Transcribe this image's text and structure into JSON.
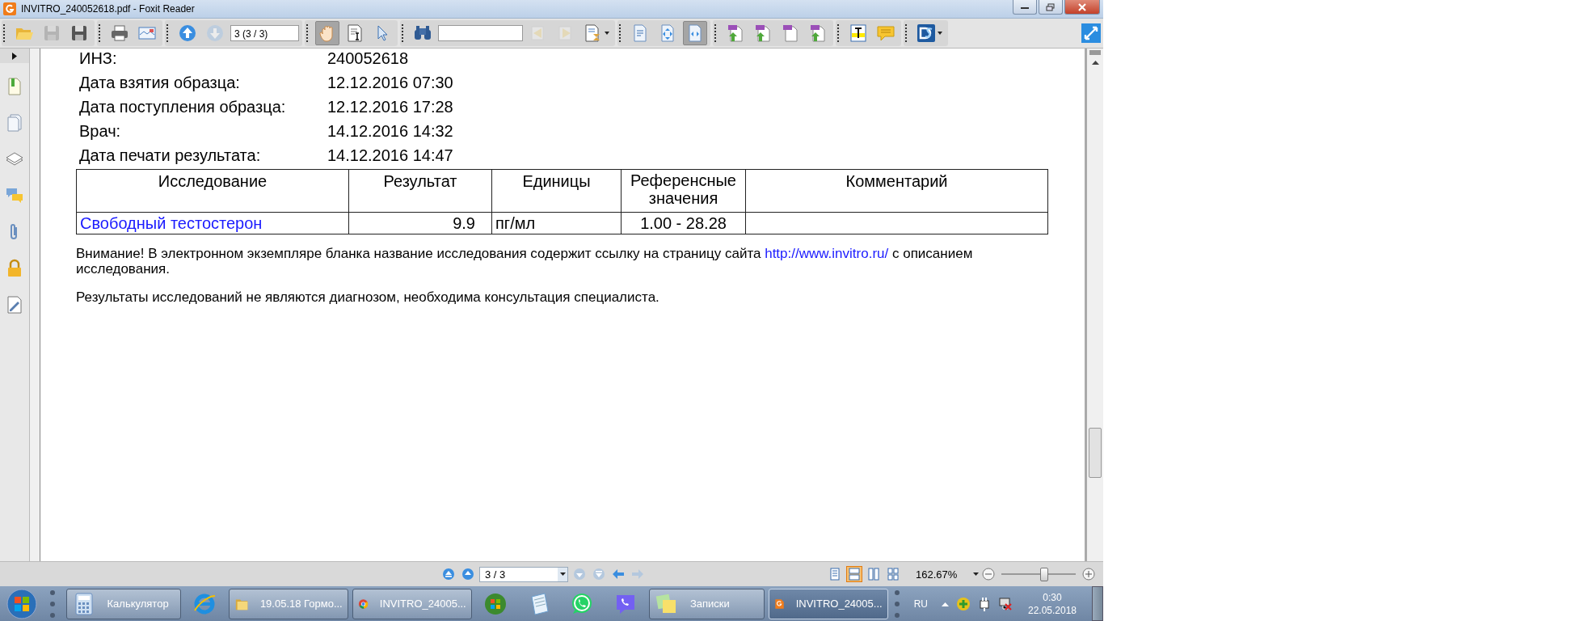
{
  "window": {
    "title": "INVITRO_240052618.pdf - Foxit Reader"
  },
  "toolbar": {
    "groups": [
      [
        {
          "kind": "open",
          "selected": false,
          "disabled": false
        },
        {
          "kind": "save",
          "selected": false,
          "disabled": true
        },
        {
          "kind": "save-as",
          "selected": false,
          "disabled": false
        }
      ],
      [
        {
          "kind": "print",
          "selected": false,
          "disabled": false
        },
        {
          "kind": "email",
          "selected": false,
          "disabled": false
        }
      ],
      [
        {
          "kind": "page-up",
          "selected": false,
          "disabled": false
        },
        {
          "kind": "page-down",
          "selected": false,
          "disabled": true
        },
        {
          "kind": "page-field",
          "value": "3 (3 / 3)"
        }
      ],
      [
        {
          "kind": "hand",
          "selected": true,
          "disabled": false
        },
        {
          "kind": "select-text",
          "selected": false,
          "disabled": false
        },
        {
          "kind": "pointer",
          "selected": false,
          "disabled": false
        }
      ],
      [
        {
          "kind": "find",
          "selected": false,
          "disabled": false
        },
        {
          "kind": "search-field"
        },
        {
          "kind": "find-prev",
          "selected": false,
          "disabled": true
        },
        {
          "kind": "find-next",
          "selected": false,
          "disabled": true
        },
        {
          "kind": "find-options",
          "selected": false,
          "disabled": false
        }
      ],
      [
        {
          "kind": "actual-size",
          "selected": false,
          "disabled": false
        },
        {
          "kind": "fit-page",
          "selected": false,
          "disabled": false
        },
        {
          "kind": "fit-width",
          "selected": true,
          "disabled": false
        }
      ],
      [
        {
          "kind": "pdf-upload",
          "selected": false,
          "disabled": false
        },
        {
          "kind": "pdf-print",
          "selected": false,
          "disabled": false
        },
        {
          "kind": "pdf-blank",
          "selected": false,
          "disabled": false
        },
        {
          "kind": "pdf-copy",
          "selected": false,
          "disabled": false
        }
      ],
      [
        {
          "kind": "typewriter",
          "selected": false,
          "disabled": false
        },
        {
          "kind": "note",
          "selected": false,
          "disabled": false
        }
      ],
      [
        {
          "kind": "app",
          "selected": false,
          "disabled": false
        }
      ]
    ]
  },
  "sidebar": {
    "items": [
      {
        "kind": "bookmarks"
      },
      {
        "kind": "pages"
      },
      {
        "kind": "layers"
      },
      {
        "kind": "comments"
      },
      {
        "kind": "attachments"
      },
      {
        "kind": "security"
      },
      {
        "kind": "signature"
      }
    ]
  },
  "document": {
    "info": [
      {
        "label": "ИНЗ:",
        "value": "240052618"
      },
      {
        "label": "Дата взятия образца:",
        "value": "12.12.2016 07:30"
      },
      {
        "label": "Дата поступления образца:",
        "value": "12.12.2016 17:28"
      },
      {
        "label": "Врач:",
        "value": "14.12.2016 14:32"
      },
      {
        "label": "Дата печати результата:",
        "value": "14.12.2016 14:47"
      }
    ],
    "table": {
      "columns": [
        "Исследование",
        "Результат",
        "Единицы",
        "Референсные значения",
        "Комментарий"
      ],
      "rows": [
        {
          "cells": [
            {
              "text": "Свободный тестостерон",
              "link": true
            },
            {
              "text": "9.9",
              "link": false
            },
            {
              "text": "пг/мл",
              "link": false
            },
            {
              "text": "1.00 - 28.28",
              "link": false
            }
          ]
        }
      ]
    },
    "notes": [
      {
        "parts": [
          {
            "text": "Внимание! В электронном экземпляре бланка название исследования содержит ссылку на страницу сайта ",
            "link": false
          },
          {
            "text": "http://www.invitro.ru/",
            "link": true
          },
          {
            "text": " с описанием исследования.",
            "link": false
          }
        ]
      },
      {
        "parts": [
          {
            "text": "Результаты исследований не являются диагнозом, необходима консультация специалиста.",
            "link": false
          }
        ]
      }
    ]
  },
  "status_bar": {
    "nav": [
      {
        "kind": "first-page",
        "disabled": false
      },
      {
        "kind": "prev-page",
        "disabled": false
      },
      {
        "kind": "page-field",
        "value": "3 / 3"
      },
      {
        "kind": "next-page",
        "disabled": true
      },
      {
        "kind": "last-page",
        "disabled": true
      },
      {
        "kind": "back",
        "disabled": false
      },
      {
        "kind": "forward",
        "disabled": true
      }
    ],
    "layouts": [
      {
        "kind": "single",
        "selected": false
      },
      {
        "kind": "continuous",
        "selected": true
      },
      {
        "kind": "facing",
        "selected": false
      },
      {
        "kind": "continuous-facing",
        "selected": false
      }
    ],
    "zoom": "162.67%",
    "zoom_slider": {
      "level": 0.56
    }
  },
  "taskbar": {
    "items": [
      {
        "kind": "calculator",
        "label": "Калькулятор",
        "active": false
      },
      {
        "kind": "ie",
        "active": false
      },
      {
        "kind": "folder",
        "label": "19.05.18 Гормо...",
        "active": false
      },
      {
        "kind": "chrome",
        "label": "INVITRO_24005...",
        "active": false
      },
      {
        "kind": "media",
        "active": false
      },
      {
        "kind": "notepad",
        "active": false
      },
      {
        "kind": "whatsapp",
        "active": false
      },
      {
        "kind": "viber",
        "active": false
      },
      {
        "kind": "notes",
        "label": "Записки",
        "active": false
      },
      {
        "kind": "foxit",
        "label": "INVITRO_24005...",
        "active": true
      }
    ],
    "tray": {
      "language": "RU",
      "time": "0:30",
      "date": "22.05.2018"
    }
  }
}
